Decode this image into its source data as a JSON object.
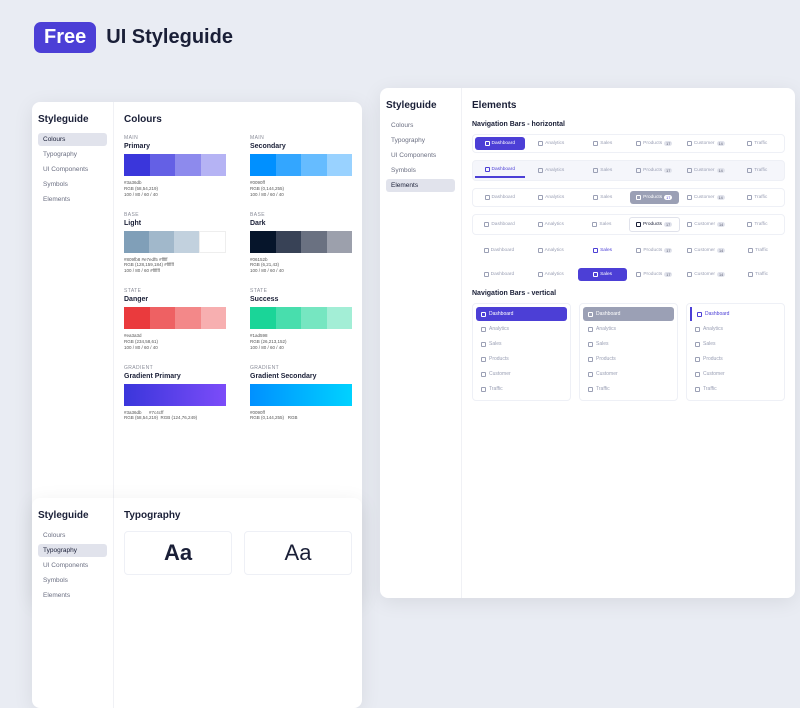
{
  "header": {
    "badge": "Free",
    "title": "UI Styleguide"
  },
  "sidebar": {
    "title": "Styleguide",
    "items": [
      "Colours",
      "Typography",
      "UI Components",
      "Symbols",
      "Elements"
    ]
  },
  "colours": {
    "title": "Colours",
    "primary": {
      "cat": "MAIN",
      "name": "Primary",
      "hex": "#3a36db",
      "rgb": "RGB (58,54,219)",
      "shades": "100 / 80 / 60 / 40",
      "c": [
        "#3a36db",
        "#6460e5",
        "#8d8aed",
        "#b5b3f4"
      ]
    },
    "secondary": {
      "cat": "MAIN",
      "name": "Secondary",
      "hex": "#0090ff",
      "rgb": "RGB (0,144,255)",
      "shades": "100 / 80 / 60 / 40",
      "c": [
        "#0090ff",
        "#33a6ff",
        "#66bcff",
        "#99d2ff"
      ]
    },
    "light": {
      "cat": "BASE",
      "name": "Light",
      "hex": "#809fb8",
      "hex2": "#e7edf5  #fffff",
      "rgb": "RGB (128,159,184)  #ffffff",
      "shades": "100 / 80 / 60 #ffffff",
      "c": [
        "#809fb8",
        "#a1b8cb",
        "#c2d1de",
        "#ffffff"
      ]
    },
    "dark": {
      "cat": "BASE",
      "name": "Dark",
      "hex": "#06152b",
      "rgb": "RGB (6,21,43)",
      "shades": "100 / 80 / 60 / 40",
      "c": [
        "#06152b",
        "#384256",
        "#6a7181",
        "#9ca0ac"
      ]
    },
    "danger": {
      "cat": "STATE",
      "name": "Danger",
      "hex": "#ea3a3d",
      "rgb": "RGB (234,58,61)",
      "shades": "100 / 80 / 60 / 40",
      "c": [
        "#ea3a3d",
        "#ee6163",
        "#f38889",
        "#f7afb0"
      ]
    },
    "success": {
      "cat": "STATE",
      "name": "Success",
      "hex": "#1ad598",
      "rgb": "RGB (26,213,152)",
      "shades": "100 / 80 / 60 / 40",
      "c": [
        "#1ad598",
        "#48dead",
        "#76e6c1",
        "#a3eed6"
      ]
    },
    "gprimary": {
      "cat": "GRADIENT",
      "name": "Gradient Primary",
      "hex": "#3a36db",
      "hex2": "#7c4cff",
      "rgb": "RGB (58,54,219)",
      "rgb2": "RGB (124,76,249)",
      "g": "linear-gradient(90deg,#3a36db,#7c4cf9)"
    },
    "gsecondary": {
      "cat": "GRADIENT",
      "name": "Gradient Secondary",
      "hex": "#0090ff",
      "hex2": "#00c2ff",
      "rgb": "RGB (0,144,255)",
      "rgb2": "RGB",
      "g": "linear-gradient(90deg,#0090ff,#00d2ff)"
    }
  },
  "typography": {
    "title": "Typography",
    "sample": "Aa"
  },
  "elements": {
    "title": "Elements",
    "nav_h": "Navigation Bars - horizontal",
    "nav_v": "Navigation Bars - vertical",
    "items": [
      {
        "label": "Dashboard"
      },
      {
        "label": "Analytics"
      },
      {
        "label": "Sales"
      },
      {
        "label": "Products",
        "badge": "17"
      },
      {
        "label": "Customer",
        "badge": "14"
      },
      {
        "label": "Traffic"
      }
    ]
  }
}
